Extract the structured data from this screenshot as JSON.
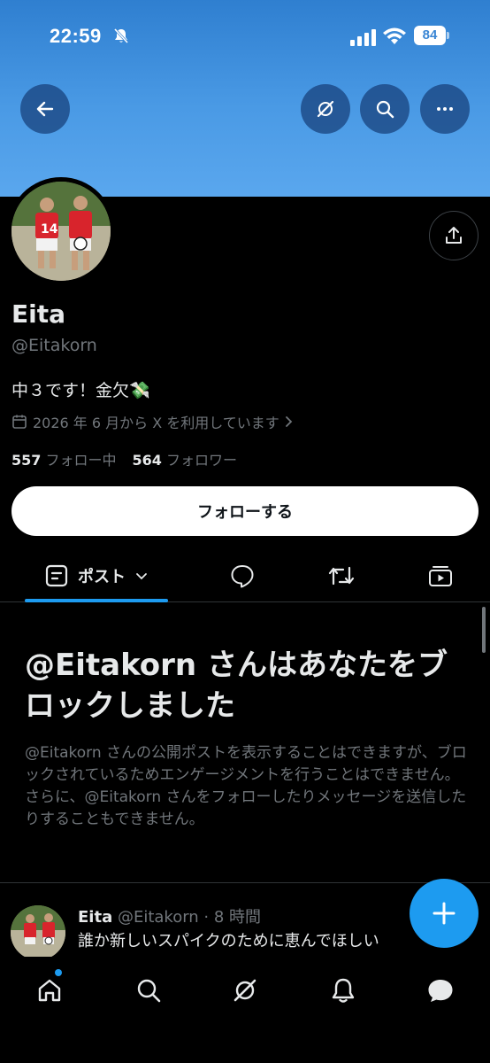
{
  "status_bar": {
    "time": "22:59",
    "battery": "84"
  },
  "icons": {
    "back": "arrow-left-icon",
    "grok": "grok-slash-icon",
    "search": "search-icon",
    "more": "more-horizontal-icon",
    "share": "share-icon",
    "calendar": "calendar-icon"
  },
  "profile": {
    "name": "Eita",
    "handle": "@Eitakorn",
    "bio": "中３です！金欠💸",
    "joined": "2026 年 6 月から X を利用しています",
    "following_count": "557",
    "following_label": "フォロー中",
    "followers_count": "564",
    "followers_label": "フォロワー",
    "follow_button": "フォローする"
  },
  "tabs": {
    "posts_label": "ポスト"
  },
  "blocked": {
    "title": "@Eitakorn さんはあなたをブロックしました",
    "description": "@Eitakorn さんの公開ポストを表示することはできますが、ブロックされているためエンゲージメントを行うことはできません。さらに、@Eitakorn さんをフォローしたりメッセージを送信したりすることもできません。"
  },
  "post": {
    "name": "Eita",
    "meta": "@Eitakorn · 8 時間",
    "text": "誰か新しいスパイクのために恵んでほしい"
  },
  "colors": {
    "accent": "#1d9bf0",
    "banner": "#4a9ae5",
    "muted": "#71767b"
  }
}
